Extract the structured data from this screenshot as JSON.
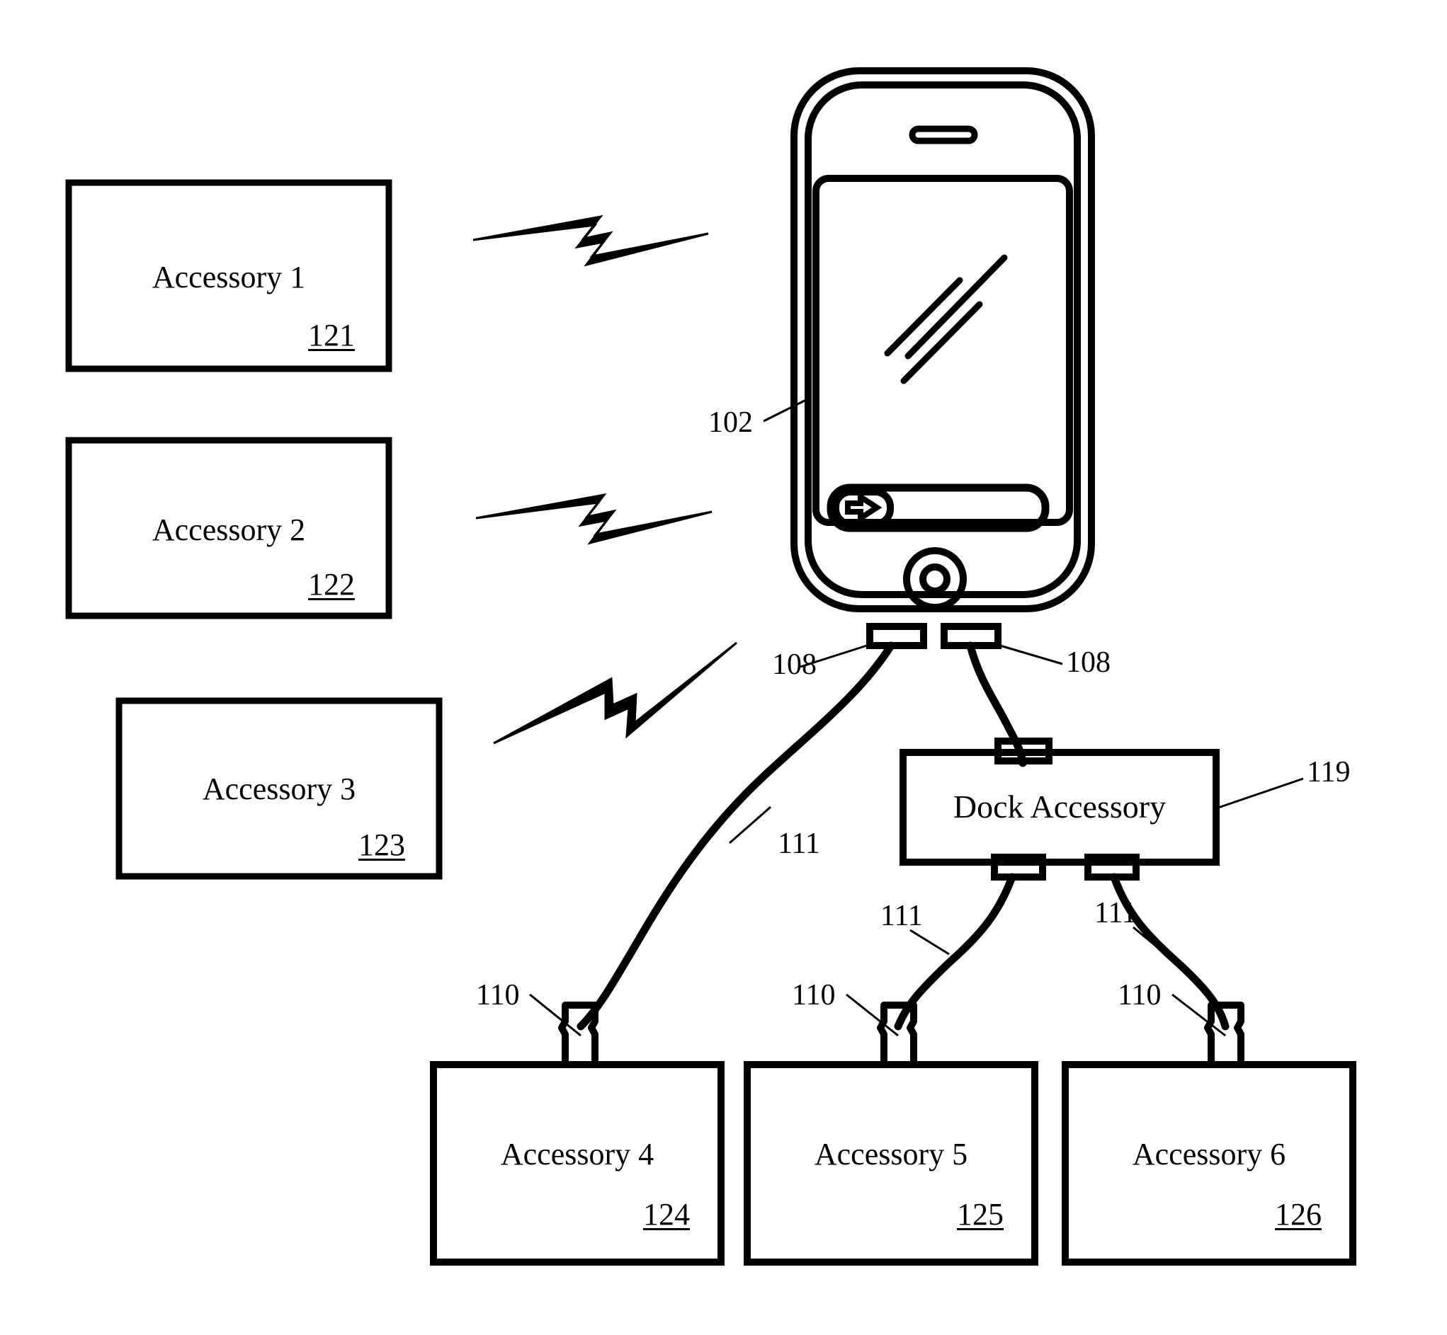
{
  "figure": {
    "type": "patent-diagram",
    "background_color": "#ffffff",
    "line_color": "#000000"
  },
  "wireless_accessories": [
    {
      "label": "Accessory 1",
      "ref": "121"
    },
    {
      "label": "Accessory 2",
      "ref": "122"
    },
    {
      "label": "Accessory 3",
      "ref": "123"
    }
  ],
  "wired_accessories": [
    {
      "label": "Accessory 4",
      "ref": "124"
    },
    {
      "label": "Accessory 5",
      "ref": "125"
    },
    {
      "label": "Accessory 6",
      "ref": "126"
    }
  ],
  "dock": {
    "label": "Dock Accessory",
    "ref": "119"
  },
  "device": {
    "ref": "102",
    "screen_unlock_icon": "right-arrow-icon"
  },
  "connector_refs": {
    "device_port_left": "108",
    "device_port_right": "108",
    "cable_to_accessory4": "111",
    "cable_to_accessory5": "111",
    "cable_to_accessory6": "111",
    "plug_accessory4": "110",
    "plug_accessory5": "110",
    "plug_accessory6": "110"
  },
  "wireless_links": [
    {
      "name": "lightning-bolt-1",
      "to": "Accessory 1"
    },
    {
      "name": "lightning-bolt-2",
      "to": "Accessory 2"
    },
    {
      "name": "lightning-bolt-3",
      "to": "Accessory 3"
    }
  ]
}
